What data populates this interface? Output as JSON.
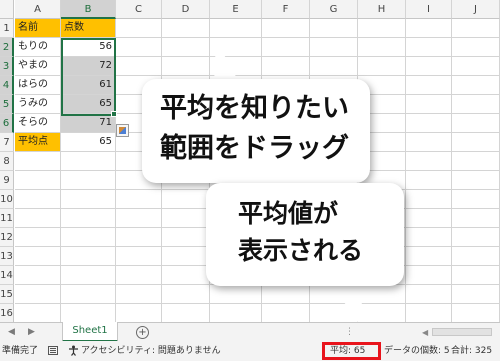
{
  "columns": [
    "A",
    "B",
    "C",
    "D",
    "E",
    "F",
    "G",
    "H",
    "I",
    "J"
  ],
  "rows": [
    "1",
    "2",
    "3",
    "4",
    "5",
    "6",
    "7",
    "8",
    "9",
    "10",
    "11",
    "12",
    "13",
    "14",
    "15",
    "16"
  ],
  "table": {
    "header": {
      "name": "名前",
      "score": "点数"
    },
    "data_rows": [
      {
        "name": "もりの",
        "score": "56"
      },
      {
        "name": "やまの",
        "score": "72"
      },
      {
        "name": "はらの",
        "score": "61"
      },
      {
        "name": "うみの",
        "score": "65"
      },
      {
        "name": "そらの",
        "score": "71"
      }
    ],
    "avg_row": {
      "name": "平均点",
      "score": "65"
    }
  },
  "callout1": {
    "line1": "平均を知りたい",
    "line2": "範囲をドラッグ"
  },
  "callout2": {
    "line1": "平均値が",
    "line2": "表示される"
  },
  "tabs": {
    "sheet_name": "Sheet1",
    "add_symbol": "+",
    "nav_left": "◀",
    "nav_right": "▶",
    "dots": "⋮",
    "scroll_left": "◀"
  },
  "status": {
    "ready": "準備完了",
    "accessibility": "アクセシビリティ: 問題ありません",
    "average": "平均: 65",
    "count": "データの個数: 5",
    "sum": "合計: 325"
  },
  "colors": {
    "header_fill": "#ffc000",
    "selection_fill": "#d0d0d0",
    "excel_green": "#217346",
    "highlight_red": "#e8141c"
  },
  "icons": [
    "quick-analysis-icon",
    "macro-record-icon",
    "accessibility-icon",
    "add-sheet-icon"
  ]
}
